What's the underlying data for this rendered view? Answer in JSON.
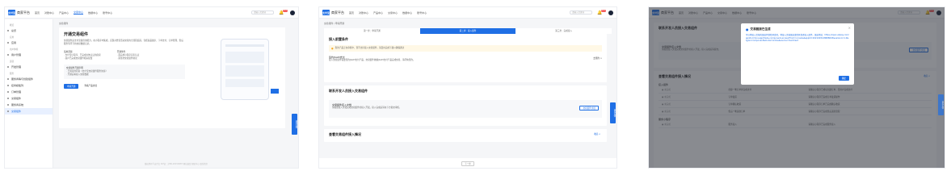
{
  "brand": {
    "mark": "支付宝",
    "name": "商家平台"
  },
  "nav": [
    "首页",
    "对账中心",
    "产品中心",
    "交易中心",
    "数据中心",
    "账号中心"
  ],
  "search_placeholder": "请输入关键词",
  "bell_badge": "99+",
  "panel1": {
    "sidebar": [
      {
        "type": "group",
        "label": "概览"
      },
      {
        "type": "item",
        "label": "总览"
      },
      {
        "type": "group",
        "label": "应用"
      },
      {
        "type": "item",
        "label": "应用"
      },
      {
        "type": "group",
        "label": "用户体验"
      },
      {
        "type": "item",
        "label": "用户管理"
      },
      {
        "type": "group",
        "label": "运营"
      },
      {
        "type": "item",
        "label": "开发管理"
      },
      {
        "type": "group",
        "label": "服务"
      },
      {
        "type": "item",
        "label": "服务商等与创建组件"
      },
      {
        "type": "item",
        "label": "接商模板列"
      },
      {
        "type": "item",
        "label": "订单管理"
      },
      {
        "type": "item",
        "label": "交易组件"
      },
      {
        "type": "item",
        "label": "服务商系统"
      },
      {
        "type": "item",
        "label": "交易组件",
        "active": true
      }
    ],
    "crumb": "交易组件",
    "title": "开通交易组件",
    "desc": "交易组件是支付宝提供的能力，在小程序中集成，实现对经营活动交易的全流程追踪，包括商品展示、下单支付、订单管理、售后服务等环节的交易数据记录。",
    "steps_title_left": "适用范围",
    "steps_left": [
      "· 支付宝小程序、已完成主体认证的商家",
      "· 商户已完成交易组件相关配置"
    ],
    "steps_title_right": "开通条件",
    "steps_right": [
      "· 需完成小程序实名认证",
      "· 需签约交易组件协议"
    ],
    "notice_title": "交易组件开通声明",
    "notice_items": [
      "· 已阅读并同意《支付宝交易组件服务协议》",
      "· 开通后将接入交易数据"
    ],
    "btn_primary": "申请开通",
    "btn_secondary": "查看产品文档",
    "footer": "版权所有©支付宝  ICP证：沪B2-20150087  网站备案  帮助中心  联系我们",
    "float_label": "意见反馈"
  },
  "panel2": {
    "crumb": "交易组件 / 申请开通",
    "steps": [
      "第一步：申请开通",
      "第二步：接入组件",
      "第三步：完成接入"
    ],
    "active_step": 1,
    "sec1_title": "接入前置条件",
    "warn": "您的产品正在审核中，暂不支持接入交易组件，请及时完成下载以确保通过",
    "jsapi_title": "签约JSAPI支付",
    "jsapi_desc": "接入交易组件需要签约JSAPI支付产品，交易组件依赖JSAPI支付产品完成交易，请尽快签约。",
    "jsapi_link": "去签约 >",
    "sec2_title": "联系开发人员接入交易组件",
    "doc_title": "交易组件接入文档",
    "doc_desc": "请按照接入文档完成交易组件的接入开发，接入完成后请在下方提交审核。",
    "doc_btn": "交易组件文档",
    "sec3_title": "查看交易组件接入情况",
    "sec3_link": "收起 ∧",
    "bottom_btn": "下一步",
    "float_label": "意见反馈"
  },
  "panel3": {
    "sec_title": "联系开发人员接入交易组件",
    "doc_title": "交易组件接入文档",
    "doc_desc": "请按照接入文档完成交易组件的接入开发，接入完成后请提交。",
    "doc_btn": "交易组件文档",
    "modal_title": "交易链接已生成",
    "modal_body": "可以将接入文档的链接复制给开发者，将接入文档链接发给开发者接入组件。链接地址：https://open.alipay.com/api/doc/mini-app/trade-component-access?from=console&appId=2021003128688003&version=1.0&type=component&mode=online&source=merchant",
    "modal_btn": "确定",
    "sec2_title": "查看交易组件接入情况",
    "sec2_link": "收起 ∧",
    "list_title": "接入组件",
    "rows": [
      {
        "name": "● 未完成",
        "step": "创建一笔订单并完成支付",
        "desc": "请确认小程序已成功创建订单，且用户完成支付"
      },
      {
        "name": "● 未完成",
        "step": "订单发货",
        "desc": "请确认小程序已完成订单发货操作"
      },
      {
        "name": "● 未完成",
        "step": "订单确认收货",
        "desc": "请确认小程序订单已完成确认收货"
      },
      {
        "name": "● 未完成",
        "step": "售后一笔退款订单",
        "desc": "请确认小程序已完成售后退款流程"
      }
    ],
    "sub_title": "服务小程序",
    "rows2": [
      {
        "name": "● 未完成",
        "step": "服务接入",
        "desc": "请确认小程序已完成服务接入"
      }
    ],
    "float_label": "意见反馈"
  }
}
